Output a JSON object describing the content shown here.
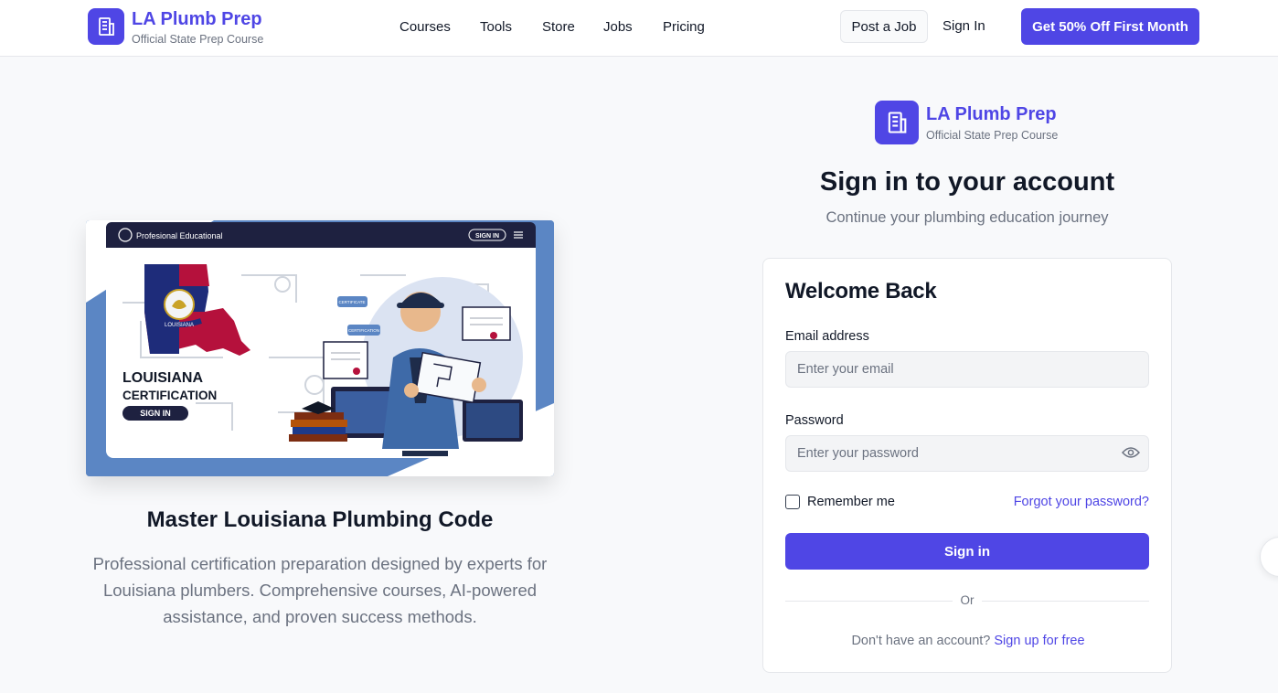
{
  "colors": {
    "brand": "#4f46e5",
    "muted": "#6b7280",
    "text": "#111827"
  },
  "header": {
    "brand_name": "LA Plumb Prep",
    "brand_sub": "Official State Prep Course",
    "nav": [
      "Courses",
      "Tools",
      "Store",
      "Jobs",
      "Pricing"
    ],
    "post_job": "Post a Job",
    "sign_in": "Sign In",
    "promo": "Get 50% Off First Month"
  },
  "hero": {
    "image": {
      "bar_text": "Profesional Educational",
      "bar_button": "SIGN IN",
      "heading_line1": "LOUISIANA",
      "heading_line2": "CERTIFICATION",
      "button": "SIGN IN",
      "state_banner": "LOUISIANA",
      "cert_tag1": "CERTIFICATE",
      "cert_tag2": "CERTIFICATION"
    },
    "title": "Master Louisiana Plumbing Code",
    "description": "Professional certification preparation designed by experts for Louisiana plumbers. Comprehensive courses, AI-powered assistance, and proven success methods."
  },
  "auth": {
    "brand_name": "LA Plumb Prep",
    "brand_sub": "Official State Prep Course",
    "title": "Sign in to your account",
    "subtitle": "Continue your plumbing education journey",
    "card": {
      "heading": "Welcome Back",
      "email_label": "Email address",
      "email_placeholder": "Enter your email",
      "password_label": "Password",
      "password_placeholder": "Enter your password",
      "remember": "Remember me",
      "forgot": "Forgot your password?",
      "submit": "Sign in",
      "divider": "Or",
      "signup_prompt": "Don't have an account?",
      "signup_link": "Sign up for free"
    }
  }
}
